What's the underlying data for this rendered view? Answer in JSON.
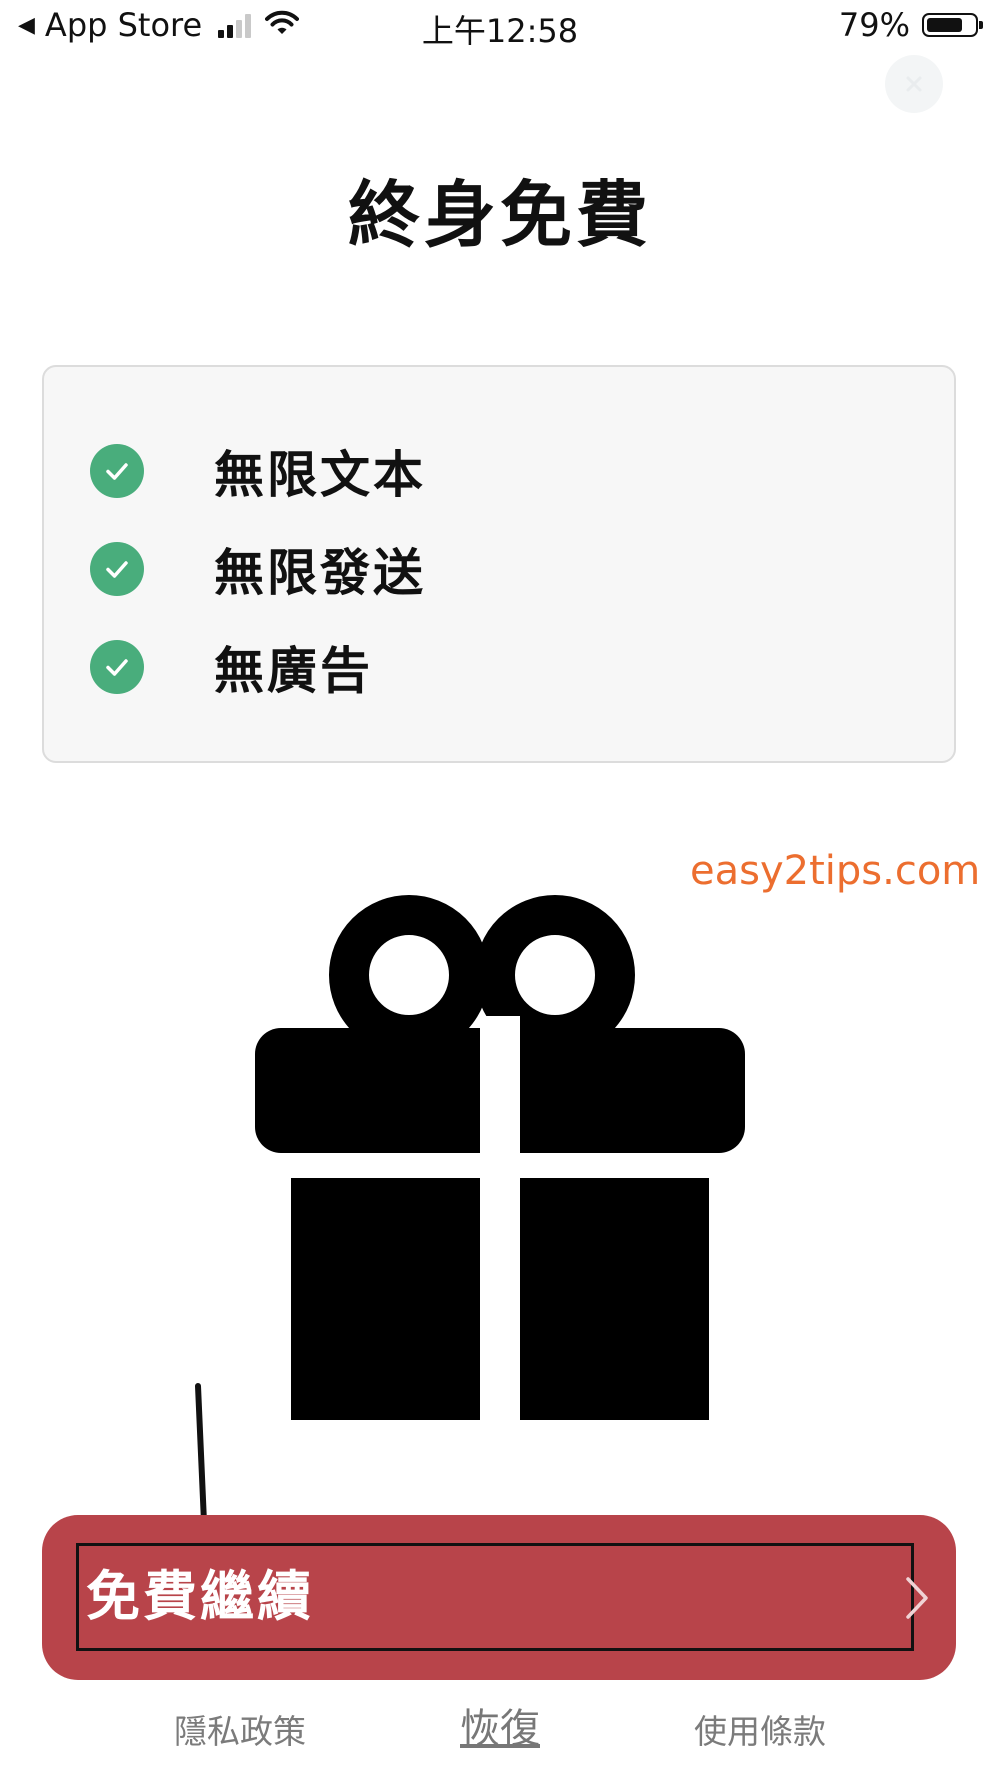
{
  "status_bar": {
    "back_label": "App Store",
    "time": "上午12:58",
    "battery_percent": "79%",
    "battery_level": 0.79
  },
  "title": "終身免費",
  "features": [
    {
      "label": "無限文本",
      "icon": "check-circle-icon"
    },
    {
      "label": "無限發送",
      "icon": "check-circle-icon"
    },
    {
      "label": "無廣告",
      "icon": "check-circle-icon"
    }
  ],
  "watermark": "easy2tips.com",
  "hero_icon": "gift-icon",
  "continue_button": {
    "label": "免費繼續",
    "icon": "chevron-right-icon"
  },
  "footer": {
    "privacy": "隱私政策",
    "restore": "恢復",
    "terms": "使用條款"
  },
  "colors": {
    "accent_check": "#49ad7c",
    "button": "#b8444a",
    "watermark": "#ec6e2f"
  }
}
